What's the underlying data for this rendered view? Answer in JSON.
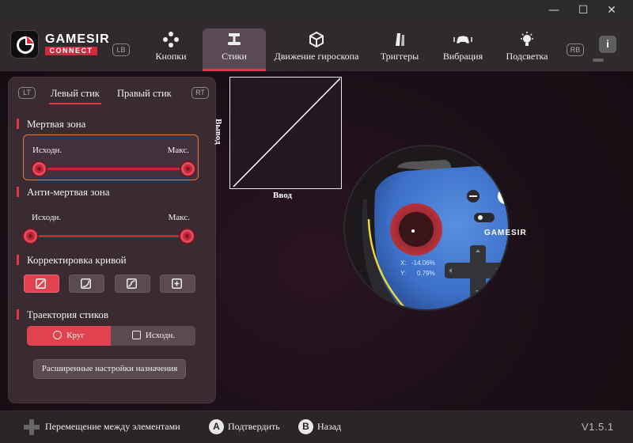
{
  "window": {
    "min_glyph": "—",
    "max_glyph": "☐",
    "close_glyph": "✕"
  },
  "brand": {
    "line1": "GAMESIR",
    "line2": "CONNECT"
  },
  "header": {
    "lb": "LB",
    "rb": "RB",
    "info": "i",
    "tabs": [
      {
        "label": "Кнопки",
        "icon": "gamepad-buttons-icon"
      },
      {
        "label": "Стики",
        "icon": "joystick-icon",
        "active": true
      },
      {
        "label": "Движение гироскопа",
        "icon": "cube-gyro-icon"
      },
      {
        "label": "Триггеры",
        "icon": "trigger-icon"
      },
      {
        "label": "Вибрация",
        "icon": "vibration-icon"
      },
      {
        "label": "Подсветка",
        "icon": "lightbulb-icon"
      }
    ]
  },
  "panel": {
    "lt": "LT",
    "rt": "RT",
    "left_stick": "Левый стик",
    "right_stick": "Правый стик",
    "deadzone": {
      "title": "Мертвая зона",
      "min": "Исходн.",
      "max": "Макс."
    },
    "anti_deadzone": {
      "title": "Анти-мертвая зона",
      "min": "Исходн.",
      "max": "Макс."
    },
    "curve": {
      "title": "Корректировка кривой"
    },
    "trajectory": {
      "title": "Траектория стиков",
      "opt1": "Круг",
      "opt2": "Исходн."
    },
    "advanced": "Расширенные настройки назначения"
  },
  "graph": {
    "xlabel": "Ввод",
    "ylabel": "Вывод"
  },
  "controller": {
    "x_label": "X:",
    "x_value": "-14.06%",
    "y_label": "Y:",
    "y_value": "0.79%",
    "brand": "GAMESIR"
  },
  "footer": {
    "navigate": "Перемещение между элементами",
    "a_key": "A",
    "confirm": "Подтвердить",
    "b_key": "B",
    "back": "Назад",
    "version": "V1.5.1"
  }
}
